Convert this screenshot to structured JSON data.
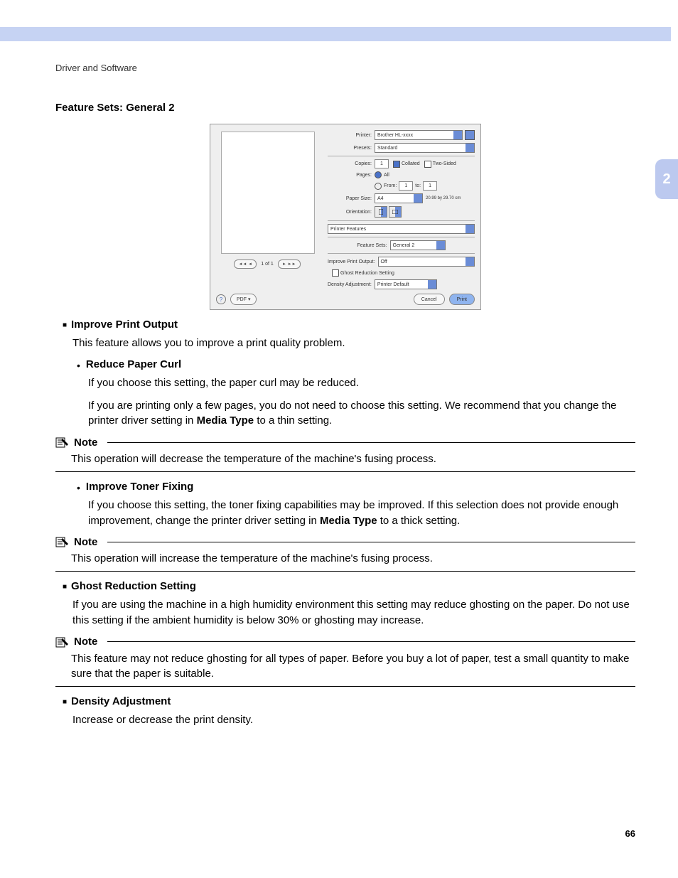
{
  "header": {
    "section": "Driver and Software"
  },
  "chapter": "2",
  "page_number": "66",
  "title": "Feature Sets: General 2",
  "dialog": {
    "printer_label": "Printer:",
    "printer_value": "Brother HL-xxxx",
    "presets_label": "Presets:",
    "presets_value": "Standard",
    "copies_label": "Copies:",
    "copies_value": "1",
    "collated_label": "Collated",
    "two_sided_label": "Two-Sided",
    "pages_label": "Pages:",
    "pages_all": "All",
    "pages_from": "From:",
    "pages_from_value": "1",
    "pages_to": "to:",
    "pages_to_value": "1",
    "paper_size_label": "Paper Size:",
    "paper_size_value": "A4",
    "paper_dims": "20.99 by 29.70 cm",
    "orientation_label": "Orientation:",
    "panel_name": "Printer Features",
    "feature_sets_label": "Feature Sets:",
    "feature_sets_value": "General 2",
    "improve_label": "Improve Print Output:",
    "improve_value": "Off",
    "ghost_label": "Ghost Reduction Setting",
    "density_label": "Density Adjustment:",
    "density_value": "Printer Default",
    "pager": "1 of 1",
    "pdf_button": "PDF ▾",
    "cancel": "Cancel",
    "print": "Print",
    "help": "?"
  },
  "sections": {
    "improve": {
      "title": "Improve Print Output",
      "intro": "This feature allows you to improve a print quality problem.",
      "reduce_curl": {
        "title": "Reduce Paper Curl",
        "p1": "If you choose this setting, the paper curl may be reduced.",
        "p2a": "If you are printing only a few pages, you do not need to choose this setting. We recommend that you change the printer driver setting in ",
        "p2b": "Media Type",
        "p2c": " to a thin setting."
      },
      "note1": {
        "label": "Note",
        "body": "This operation will decrease the temperature of the machine's fusing process."
      },
      "toner_fix": {
        "title": "Improve Toner Fixing",
        "p1a": "If you choose this setting, the toner fixing capabilities may be improved. If this selection does not provide enough improvement, change the printer driver setting in ",
        "p1b": "Media Type",
        "p1c": " to a thick setting."
      },
      "note2": {
        "label": "Note",
        "body": "This operation will increase the temperature of the machine's fusing process."
      }
    },
    "ghost": {
      "title": "Ghost Reduction Setting",
      "body": "If you are using the machine in a high humidity environment this setting may reduce ghosting on the paper. Do not use this setting if the ambient humidity is below 30% or ghosting may increase.",
      "note": {
        "label": "Note",
        "body": "This feature may not reduce ghosting for all types of paper. Before you buy a lot of paper, test a small quantity to make sure that the paper is suitable."
      }
    },
    "density": {
      "title": "Density Adjustment",
      "body": "Increase or decrease the print density."
    }
  }
}
